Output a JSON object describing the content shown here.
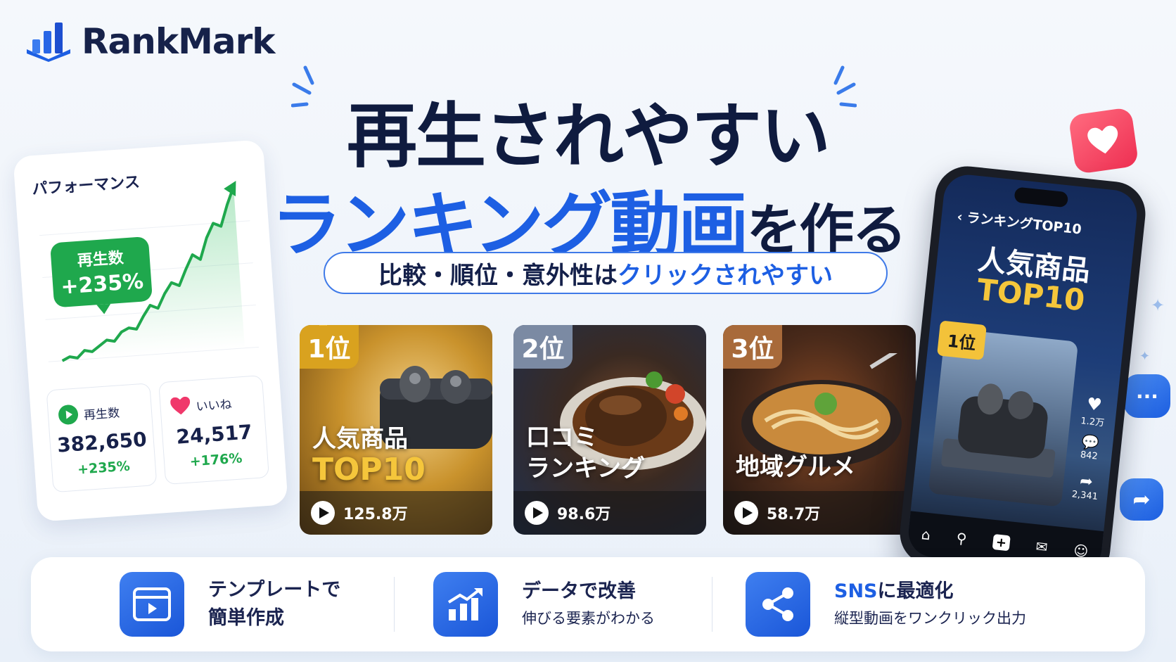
{
  "brand": {
    "name": "RankMark"
  },
  "hero": {
    "line1": "再生されやすい",
    "line2_main": "ランキング動画",
    "line2_tail": "を作る"
  },
  "tagline": {
    "prefix": "比較・順位・意外性は",
    "highlight": "クリックされやすい"
  },
  "performance": {
    "title": "パフォーマンス",
    "badge_label": "再生数",
    "badge_value": "+235%",
    "stats": [
      {
        "label": "再生数",
        "value": "382,650",
        "change": "+235%",
        "icon": "play-icon"
      },
      {
        "label": "いいね",
        "value": "24,517",
        "change": "+176%",
        "icon": "heart-icon"
      }
    ],
    "trend": [
      8,
      10,
      9,
      13,
      12,
      15,
      18,
      17,
      22,
      24,
      23,
      30,
      36,
      34,
      42,
      48,
      46,
      55,
      63,
      60,
      72,
      80,
      78,
      90,
      100
    ]
  },
  "cards": [
    {
      "rank": "1位",
      "title1": "人気商品",
      "title2": "TOP10",
      "views": "125.8万",
      "accent": "#d9a21f"
    },
    {
      "rank": "2位",
      "title1": "口コミ",
      "title2": "ランキング",
      "views": "98.6万",
      "accent": "#7b8aa3"
    },
    {
      "rank": "3位",
      "title1": "地域グルメ",
      "title2": "",
      "views": "58.7万",
      "accent": "#a86a3a"
    }
  ],
  "phone": {
    "header": "ランキングTOP10",
    "title1": "人気商品",
    "title2": "TOP10",
    "rank": "1位",
    "likes": "1.2万",
    "comments": "842",
    "shares": "2,341"
  },
  "features": [
    {
      "title1": "テンプレートで",
      "title2": "簡単作成",
      "icon": "video-template-icon"
    },
    {
      "title1": "データで改善",
      "sub": "伸びる要素がわかる",
      "icon": "chart-up-icon"
    },
    {
      "title_sns": "SNS",
      "title_rest": "に最適化",
      "sub": "縦型動画をワンクリック出力",
      "icon": "share-icon"
    }
  ],
  "colors": {
    "brand_blue": "#1d5fe3",
    "navy": "#0f1b3f",
    "green": "#1fa84d",
    "gold": "#f5c63b"
  }
}
